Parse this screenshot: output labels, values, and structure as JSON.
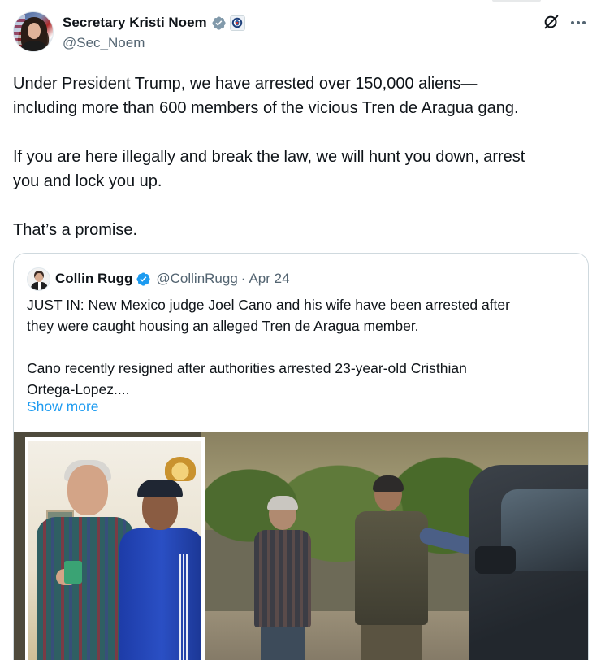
{
  "author": {
    "display_name": "Secretary Kristi Noem",
    "handle": "@Sec_Noem"
  },
  "tweet": {
    "text": "Under President Trump, we have arrested over 150,000 aliens—\nincluding more than 600 members of the vicious Tren de Aragua gang.\n\nIf you are here illegally and break the law, we will hunt you down, arrest\nyou and lock you up.\n\nThat’s a promise."
  },
  "quoted": {
    "display_name": "Collin Rugg",
    "handle": "@CollinRugg",
    "separator": "·",
    "time": "Apr 24",
    "text": "JUST IN: New Mexico judge Joel Cano and his wife have been arrested after\nthey were caught housing an alleged Tren de Aragua member.\n\nCano recently resigned after authorities arrested 23-year-old Cristhian\nOrtega-Lopez....",
    "show_more": "Show more"
  },
  "icons": {
    "verified": "verified-badge-icon",
    "government": "government-seal-icon",
    "grok": "grok-icon",
    "more": "more-icon"
  },
  "colors": {
    "link": "#1d9bf0",
    "secondary_text": "#536471",
    "primary_text": "#0f1419",
    "verified_blue": "#1d9bf0",
    "verified_gray": "#829aab",
    "border": "#cfd9de"
  }
}
